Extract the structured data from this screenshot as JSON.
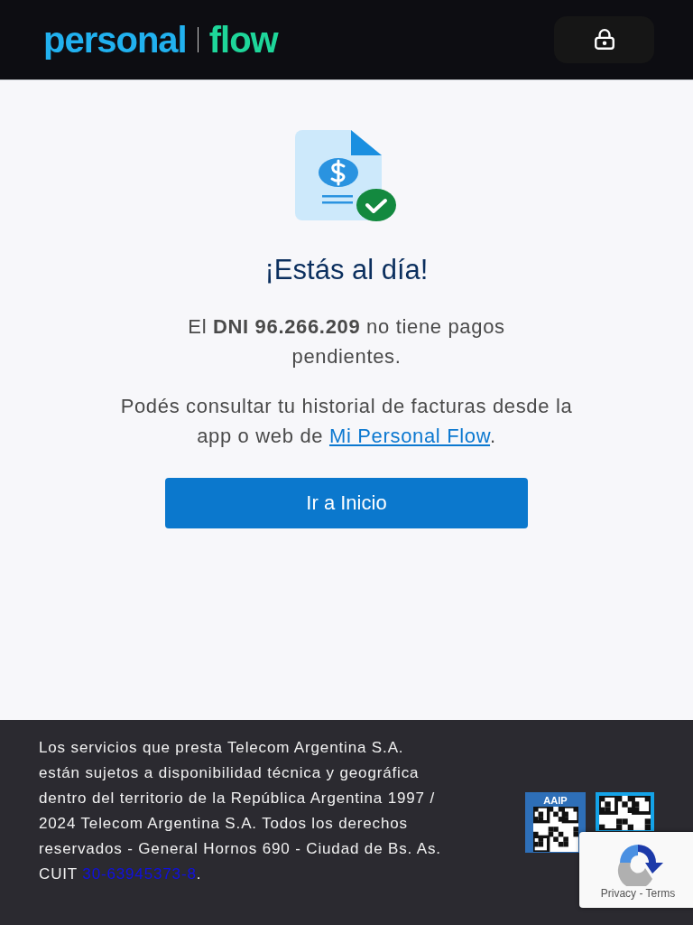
{
  "header": {
    "logo_left": "personal",
    "logo_right": "flow"
  },
  "status": {
    "title": "¡Estás al día!",
    "message": "El **DNI 96.266.209** no tiene pagos pendientes.",
    "info_before": "Podés consultar tu historial de facturas desde la app o web de ",
    "info_link": "Mi Personal Flow",
    "info_after": ".",
    "button": "Ir a Inicio"
  },
  "footer": {
    "legal": "Los servicios que presta Telecom Argentina S.A. están sujetos a disponibilidad técnica y geográfica dentro del territorio de la República Argentina 1997 / 2024 Telecom Argentina S.A. Todos los derechos reservados - General Hornos 690 - Ciudad de Bs. As. CUIT ",
    "cuit_link": "30-63945373-8",
    "legal_end": ".",
    "aaip_badge": "AAIP"
  },
  "recaptcha": {
    "links": "Privacy - Terms"
  }
}
